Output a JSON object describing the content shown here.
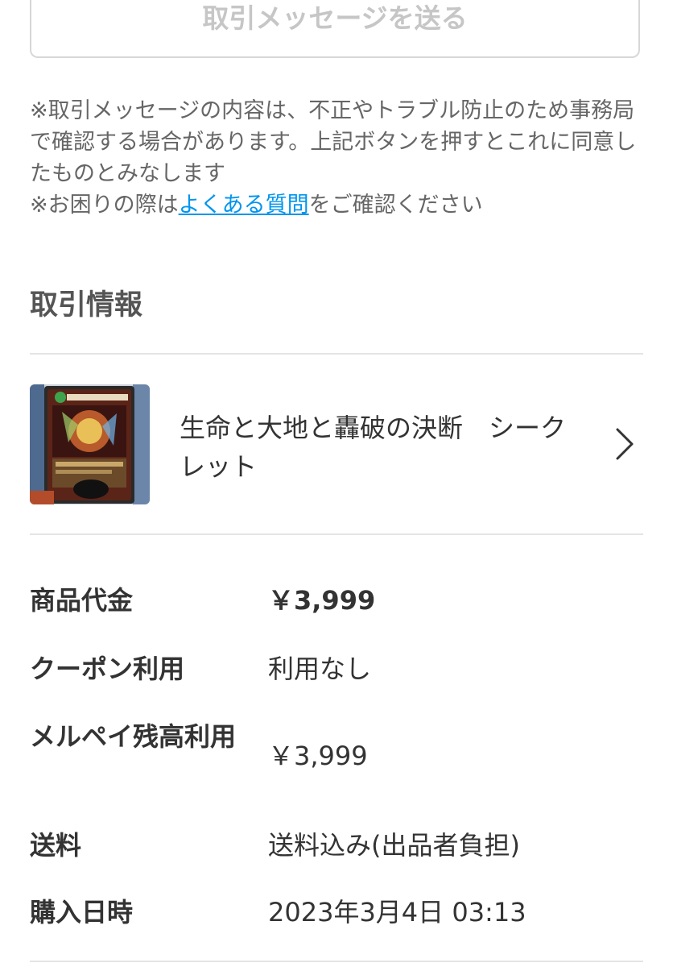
{
  "send_message_button": {
    "label": "取引メッセージを送る"
  },
  "notice": {
    "line1": "※取引メッセージの内容は、不正やトラブル防止のため事務局で確認する場合があります。上記ボタンを押すとこれに同意したものとみなします",
    "line2_prefix": "※お困りの際は",
    "line2_link": "よくある質問",
    "line2_suffix": "をご確認ください"
  },
  "transaction": {
    "section_title": "取引情報",
    "item": {
      "name": "生命と大地と轟破の決断　シークレット",
      "thumbnail_icon": "trading-card-image"
    },
    "details": [
      {
        "label": "商品代金",
        "value": "￥3,999"
      },
      {
        "label": "クーポン利用",
        "value": "利用なし"
      },
      {
        "label": "メルペイ残高利用",
        "value": "￥3,999"
      },
      {
        "label": "送料",
        "value": "送料込み(出品者負担)"
      },
      {
        "label": "購入日時",
        "value": "2023年3月4日 03:13"
      }
    ]
  },
  "colors": {
    "link": "#0095ee",
    "disabled_button_text": "#c6c6c6",
    "divider": "#e4e4e4"
  }
}
